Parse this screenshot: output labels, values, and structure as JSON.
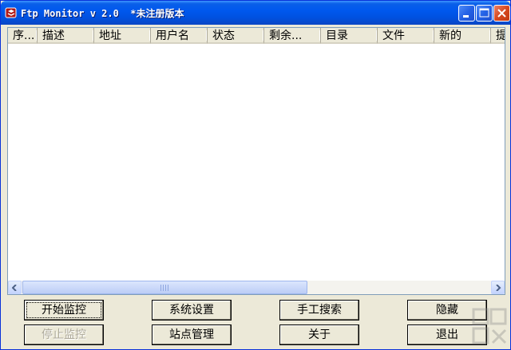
{
  "window": {
    "title": "Ftp Monitor v 2.0  *未注册版本"
  },
  "list": {
    "columns": [
      "序...",
      "描述",
      "地址",
      "用户名",
      "状态",
      "剩余...",
      "目录",
      "文件",
      "新的",
      "提"
    ]
  },
  "buttons": {
    "start": "开始监控",
    "stop": "停止监控",
    "settings": "系统设置",
    "sites": "站点管理",
    "manual_search": "手工搜索",
    "about": "关于",
    "hide": "隐藏",
    "exit": "退出"
  },
  "colors": {
    "titlebar": "#0058ee",
    "face": "#ece9d8",
    "list_border": "#7f9db9"
  }
}
